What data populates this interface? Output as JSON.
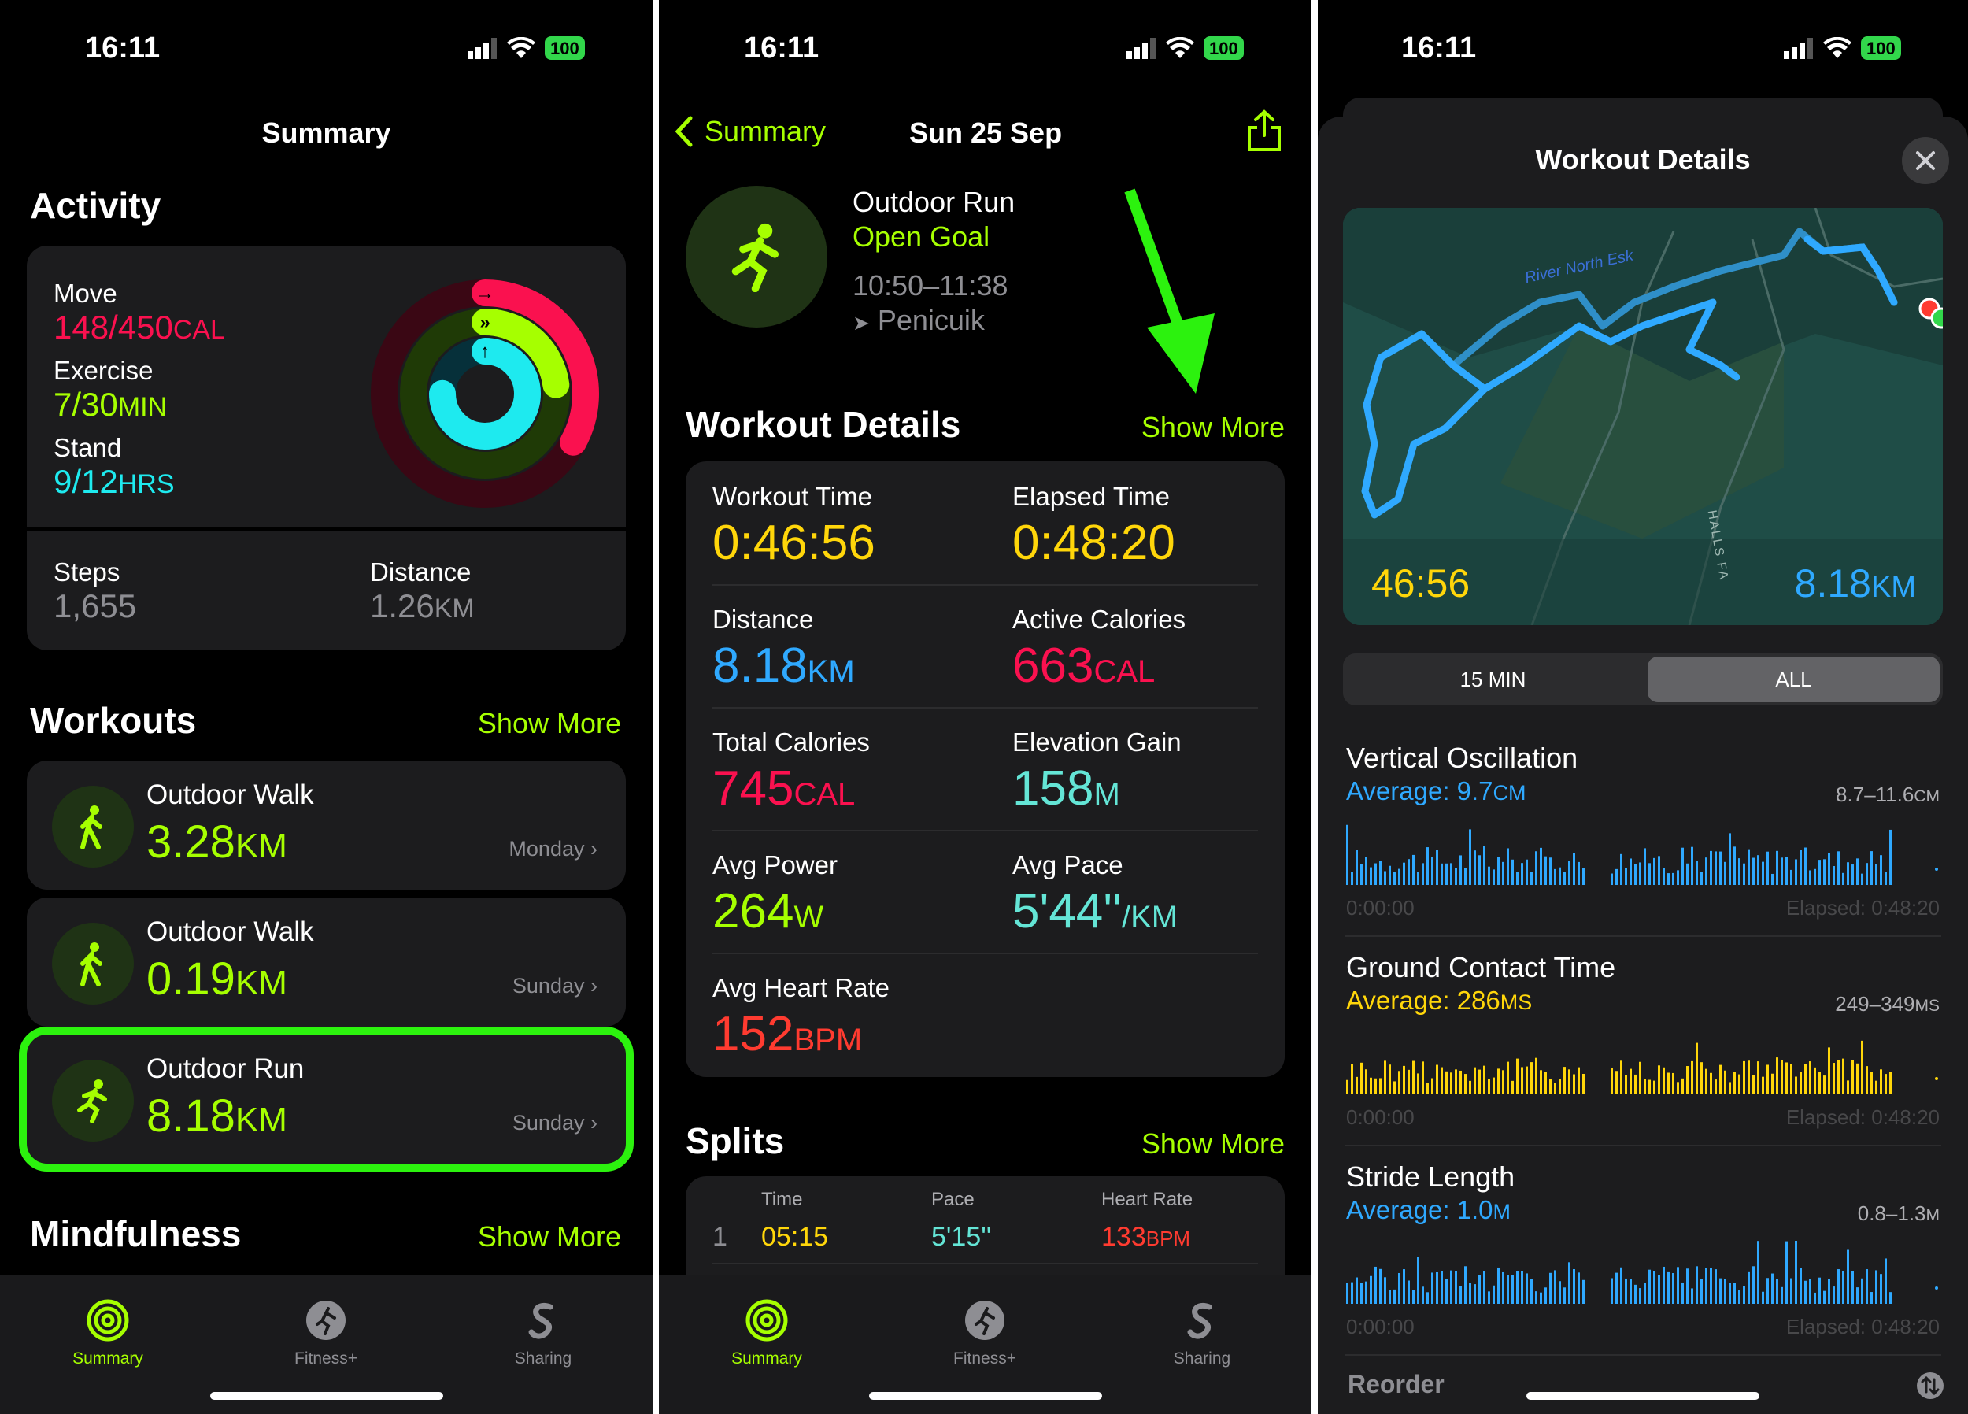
{
  "status": {
    "time": "16:11",
    "battery": "100"
  },
  "colors": {
    "accent": "#a6ff00",
    "move": "#fa114f",
    "exercise": "#a6ff00",
    "stand": "#1eeaef",
    "yellow": "#ffd60a",
    "blue": "#2fa9ff",
    "teal": "#64e5d6",
    "red": "#ff375f",
    "green": "#32d74b"
  },
  "tabbar": {
    "summary": "Summary",
    "fitness": "Fitness+",
    "sharing": "Sharing"
  },
  "screen1": {
    "nav_title": "Summary",
    "activity_title": "Activity",
    "rings": [
      {
        "label": "Move",
        "value": "148/450",
        "unit": "CAL",
        "fraction": 0.33
      },
      {
        "label": "Exercise",
        "value": "7/30",
        "unit": "MIN",
        "fraction": 0.23
      },
      {
        "label": "Stand",
        "value": "9/12",
        "unit": "HRS",
        "fraction": 0.75
      }
    ],
    "steps_label": "Steps",
    "steps_value": "1,655",
    "distance_label": "Distance",
    "distance_value": "1.26",
    "distance_unit": "KM",
    "workouts_title": "Workouts",
    "show_more": "Show More",
    "workouts": [
      {
        "name": "Outdoor Walk",
        "value": "3.28",
        "unit": "KM",
        "day": "Monday"
      },
      {
        "name": "Outdoor Walk",
        "value": "0.19",
        "unit": "KM",
        "day": "Sunday"
      },
      {
        "name": "Outdoor Run",
        "value": "8.18",
        "unit": "KM",
        "day": "Sunday"
      }
    ],
    "mindfulness_title": "Mindfulness",
    "mindfulness_show_more": "Show More"
  },
  "screen2": {
    "back_label": "Summary",
    "nav_title": "Sun 25 Sep",
    "workout_name": "Outdoor Run",
    "goal": "Open Goal",
    "time_range": "10:50–11:38",
    "location": "Penicuik",
    "details_title": "Workout Details",
    "details_show_more": "Show More",
    "details": [
      {
        "label": "Workout Time",
        "value": "0:46:56",
        "unit": ""
      },
      {
        "label": "Elapsed Time",
        "value": "0:48:20",
        "unit": ""
      },
      {
        "label": "Distance",
        "value": "8.18",
        "unit": "KM"
      },
      {
        "label": "Active Calories",
        "value": "663",
        "unit": "CAL"
      },
      {
        "label": "Total Calories",
        "value": "745",
        "unit": "CAL"
      },
      {
        "label": "Elevation Gain",
        "value": "158",
        "unit": "M"
      },
      {
        "label": "Avg Power",
        "value": "264",
        "unit": "W"
      },
      {
        "label": "Avg Pace",
        "value": "5'44''",
        "unit": "/KM"
      },
      {
        "label": "Avg Heart Rate",
        "value": "152",
        "unit": "BPM"
      }
    ],
    "splits_title": "Splits",
    "splits_show_more": "Show More",
    "splits_headers": [
      "Time",
      "Pace",
      "Heart Rate"
    ],
    "splits_rows": [
      {
        "index": "1",
        "time": "05:15",
        "pace": "5'15''",
        "hr": "133",
        "hr_unit": "BPM"
      }
    ]
  },
  "screen3": {
    "sheet_title": "Workout Details",
    "map_time": "46:56",
    "map_distance": "8.18",
    "map_distance_unit": "KM",
    "map_river_label": "River North Esk",
    "map_road_label": "HALLS FA",
    "segments": [
      "15 MIN",
      "ALL"
    ],
    "segment_selected": "ALL",
    "metrics": [
      {
        "title": "Vertical Oscillation",
        "avg_prefix": "Average: ",
        "avg": "9.7",
        "avg_unit": "CM",
        "range": "8.7–11.6",
        "range_unit": "CM",
        "start": "0:00:00",
        "end": "Elapsed: 0:48:20",
        "color": "#2fa9ff"
      },
      {
        "title": "Ground Contact Time",
        "avg_prefix": "Average: ",
        "avg": "286",
        "avg_unit": "MS",
        "range": "249–349",
        "range_unit": "MS",
        "start": "0:00:00",
        "end": "Elapsed: 0:48:20",
        "color": "#ffd60a"
      },
      {
        "title": "Stride Length",
        "avg_prefix": "Average: ",
        "avg": "1.0",
        "avg_unit": "M",
        "range": "0.8–1.3",
        "range_unit": "M",
        "start": "0:00:00",
        "end": "Elapsed: 0:48:20",
        "color": "#2fa9ff"
      }
    ],
    "reorder_label": "Reorder"
  }
}
